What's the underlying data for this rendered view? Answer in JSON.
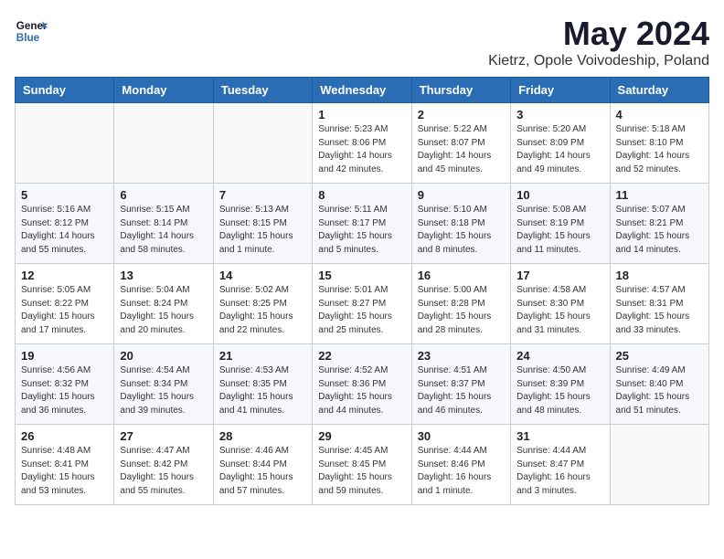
{
  "header": {
    "logo_line1": "General",
    "logo_line2": "Blue",
    "month": "May 2024",
    "location": "Kietrz, Opole Voivodeship, Poland"
  },
  "days_of_week": [
    "Sunday",
    "Monday",
    "Tuesday",
    "Wednesday",
    "Thursday",
    "Friday",
    "Saturday"
  ],
  "weeks": [
    [
      {
        "day": "",
        "info": ""
      },
      {
        "day": "",
        "info": ""
      },
      {
        "day": "",
        "info": ""
      },
      {
        "day": "1",
        "info": "Sunrise: 5:23 AM\nSunset: 8:06 PM\nDaylight: 14 hours\nand 42 minutes."
      },
      {
        "day": "2",
        "info": "Sunrise: 5:22 AM\nSunset: 8:07 PM\nDaylight: 14 hours\nand 45 minutes."
      },
      {
        "day": "3",
        "info": "Sunrise: 5:20 AM\nSunset: 8:09 PM\nDaylight: 14 hours\nand 49 minutes."
      },
      {
        "day": "4",
        "info": "Sunrise: 5:18 AM\nSunset: 8:10 PM\nDaylight: 14 hours\nand 52 minutes."
      }
    ],
    [
      {
        "day": "5",
        "info": "Sunrise: 5:16 AM\nSunset: 8:12 PM\nDaylight: 14 hours\nand 55 minutes."
      },
      {
        "day": "6",
        "info": "Sunrise: 5:15 AM\nSunset: 8:14 PM\nDaylight: 14 hours\nand 58 minutes."
      },
      {
        "day": "7",
        "info": "Sunrise: 5:13 AM\nSunset: 8:15 PM\nDaylight: 15 hours\nand 1 minute."
      },
      {
        "day": "8",
        "info": "Sunrise: 5:11 AM\nSunset: 8:17 PM\nDaylight: 15 hours\nand 5 minutes."
      },
      {
        "day": "9",
        "info": "Sunrise: 5:10 AM\nSunset: 8:18 PM\nDaylight: 15 hours\nand 8 minutes."
      },
      {
        "day": "10",
        "info": "Sunrise: 5:08 AM\nSunset: 8:19 PM\nDaylight: 15 hours\nand 11 minutes."
      },
      {
        "day": "11",
        "info": "Sunrise: 5:07 AM\nSunset: 8:21 PM\nDaylight: 15 hours\nand 14 minutes."
      }
    ],
    [
      {
        "day": "12",
        "info": "Sunrise: 5:05 AM\nSunset: 8:22 PM\nDaylight: 15 hours\nand 17 minutes."
      },
      {
        "day": "13",
        "info": "Sunrise: 5:04 AM\nSunset: 8:24 PM\nDaylight: 15 hours\nand 20 minutes."
      },
      {
        "day": "14",
        "info": "Sunrise: 5:02 AM\nSunset: 8:25 PM\nDaylight: 15 hours\nand 22 minutes."
      },
      {
        "day": "15",
        "info": "Sunrise: 5:01 AM\nSunset: 8:27 PM\nDaylight: 15 hours\nand 25 minutes."
      },
      {
        "day": "16",
        "info": "Sunrise: 5:00 AM\nSunset: 8:28 PM\nDaylight: 15 hours\nand 28 minutes."
      },
      {
        "day": "17",
        "info": "Sunrise: 4:58 AM\nSunset: 8:30 PM\nDaylight: 15 hours\nand 31 minutes."
      },
      {
        "day": "18",
        "info": "Sunrise: 4:57 AM\nSunset: 8:31 PM\nDaylight: 15 hours\nand 33 minutes."
      }
    ],
    [
      {
        "day": "19",
        "info": "Sunrise: 4:56 AM\nSunset: 8:32 PM\nDaylight: 15 hours\nand 36 minutes."
      },
      {
        "day": "20",
        "info": "Sunrise: 4:54 AM\nSunset: 8:34 PM\nDaylight: 15 hours\nand 39 minutes."
      },
      {
        "day": "21",
        "info": "Sunrise: 4:53 AM\nSunset: 8:35 PM\nDaylight: 15 hours\nand 41 minutes."
      },
      {
        "day": "22",
        "info": "Sunrise: 4:52 AM\nSunset: 8:36 PM\nDaylight: 15 hours\nand 44 minutes."
      },
      {
        "day": "23",
        "info": "Sunrise: 4:51 AM\nSunset: 8:37 PM\nDaylight: 15 hours\nand 46 minutes."
      },
      {
        "day": "24",
        "info": "Sunrise: 4:50 AM\nSunset: 8:39 PM\nDaylight: 15 hours\nand 48 minutes."
      },
      {
        "day": "25",
        "info": "Sunrise: 4:49 AM\nSunset: 8:40 PM\nDaylight: 15 hours\nand 51 minutes."
      }
    ],
    [
      {
        "day": "26",
        "info": "Sunrise: 4:48 AM\nSunset: 8:41 PM\nDaylight: 15 hours\nand 53 minutes."
      },
      {
        "day": "27",
        "info": "Sunrise: 4:47 AM\nSunset: 8:42 PM\nDaylight: 15 hours\nand 55 minutes."
      },
      {
        "day": "28",
        "info": "Sunrise: 4:46 AM\nSunset: 8:44 PM\nDaylight: 15 hours\nand 57 minutes."
      },
      {
        "day": "29",
        "info": "Sunrise: 4:45 AM\nSunset: 8:45 PM\nDaylight: 15 hours\nand 59 minutes."
      },
      {
        "day": "30",
        "info": "Sunrise: 4:44 AM\nSunset: 8:46 PM\nDaylight: 16 hours\nand 1 minute."
      },
      {
        "day": "31",
        "info": "Sunrise: 4:44 AM\nSunset: 8:47 PM\nDaylight: 16 hours\nand 3 minutes."
      },
      {
        "day": "",
        "info": ""
      }
    ]
  ]
}
